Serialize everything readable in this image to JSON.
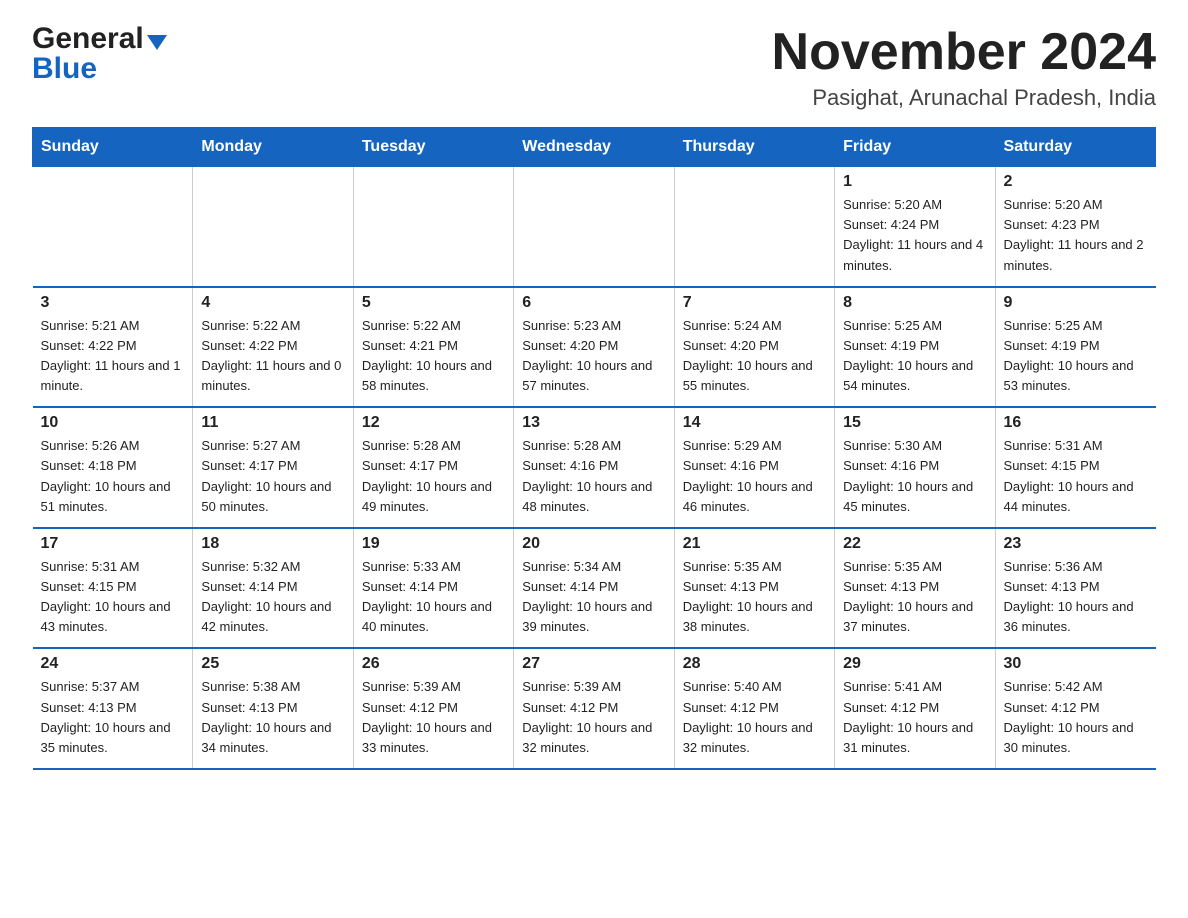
{
  "header": {
    "logo_general": "General",
    "logo_blue": "Blue",
    "month_title": "November 2024",
    "location": "Pasighat, Arunachal Pradesh, India"
  },
  "days_of_week": [
    "Sunday",
    "Monday",
    "Tuesday",
    "Wednesday",
    "Thursday",
    "Friday",
    "Saturday"
  ],
  "weeks": [
    [
      {
        "day": "",
        "info": ""
      },
      {
        "day": "",
        "info": ""
      },
      {
        "day": "",
        "info": ""
      },
      {
        "day": "",
        "info": ""
      },
      {
        "day": "",
        "info": ""
      },
      {
        "day": "1",
        "info": "Sunrise: 5:20 AM\nSunset: 4:24 PM\nDaylight: 11 hours and 4 minutes."
      },
      {
        "day": "2",
        "info": "Sunrise: 5:20 AM\nSunset: 4:23 PM\nDaylight: 11 hours and 2 minutes."
      }
    ],
    [
      {
        "day": "3",
        "info": "Sunrise: 5:21 AM\nSunset: 4:22 PM\nDaylight: 11 hours and 1 minute."
      },
      {
        "day": "4",
        "info": "Sunrise: 5:22 AM\nSunset: 4:22 PM\nDaylight: 11 hours and 0 minutes."
      },
      {
        "day": "5",
        "info": "Sunrise: 5:22 AM\nSunset: 4:21 PM\nDaylight: 10 hours and 58 minutes."
      },
      {
        "day": "6",
        "info": "Sunrise: 5:23 AM\nSunset: 4:20 PM\nDaylight: 10 hours and 57 minutes."
      },
      {
        "day": "7",
        "info": "Sunrise: 5:24 AM\nSunset: 4:20 PM\nDaylight: 10 hours and 55 minutes."
      },
      {
        "day": "8",
        "info": "Sunrise: 5:25 AM\nSunset: 4:19 PM\nDaylight: 10 hours and 54 minutes."
      },
      {
        "day": "9",
        "info": "Sunrise: 5:25 AM\nSunset: 4:19 PM\nDaylight: 10 hours and 53 minutes."
      }
    ],
    [
      {
        "day": "10",
        "info": "Sunrise: 5:26 AM\nSunset: 4:18 PM\nDaylight: 10 hours and 51 minutes."
      },
      {
        "day": "11",
        "info": "Sunrise: 5:27 AM\nSunset: 4:17 PM\nDaylight: 10 hours and 50 minutes."
      },
      {
        "day": "12",
        "info": "Sunrise: 5:28 AM\nSunset: 4:17 PM\nDaylight: 10 hours and 49 minutes."
      },
      {
        "day": "13",
        "info": "Sunrise: 5:28 AM\nSunset: 4:16 PM\nDaylight: 10 hours and 48 minutes."
      },
      {
        "day": "14",
        "info": "Sunrise: 5:29 AM\nSunset: 4:16 PM\nDaylight: 10 hours and 46 minutes."
      },
      {
        "day": "15",
        "info": "Sunrise: 5:30 AM\nSunset: 4:16 PM\nDaylight: 10 hours and 45 minutes."
      },
      {
        "day": "16",
        "info": "Sunrise: 5:31 AM\nSunset: 4:15 PM\nDaylight: 10 hours and 44 minutes."
      }
    ],
    [
      {
        "day": "17",
        "info": "Sunrise: 5:31 AM\nSunset: 4:15 PM\nDaylight: 10 hours and 43 minutes."
      },
      {
        "day": "18",
        "info": "Sunrise: 5:32 AM\nSunset: 4:14 PM\nDaylight: 10 hours and 42 minutes."
      },
      {
        "day": "19",
        "info": "Sunrise: 5:33 AM\nSunset: 4:14 PM\nDaylight: 10 hours and 40 minutes."
      },
      {
        "day": "20",
        "info": "Sunrise: 5:34 AM\nSunset: 4:14 PM\nDaylight: 10 hours and 39 minutes."
      },
      {
        "day": "21",
        "info": "Sunrise: 5:35 AM\nSunset: 4:13 PM\nDaylight: 10 hours and 38 minutes."
      },
      {
        "day": "22",
        "info": "Sunrise: 5:35 AM\nSunset: 4:13 PM\nDaylight: 10 hours and 37 minutes."
      },
      {
        "day": "23",
        "info": "Sunrise: 5:36 AM\nSunset: 4:13 PM\nDaylight: 10 hours and 36 minutes."
      }
    ],
    [
      {
        "day": "24",
        "info": "Sunrise: 5:37 AM\nSunset: 4:13 PM\nDaylight: 10 hours and 35 minutes."
      },
      {
        "day": "25",
        "info": "Sunrise: 5:38 AM\nSunset: 4:13 PM\nDaylight: 10 hours and 34 minutes."
      },
      {
        "day": "26",
        "info": "Sunrise: 5:39 AM\nSunset: 4:12 PM\nDaylight: 10 hours and 33 minutes."
      },
      {
        "day": "27",
        "info": "Sunrise: 5:39 AM\nSunset: 4:12 PM\nDaylight: 10 hours and 32 minutes."
      },
      {
        "day": "28",
        "info": "Sunrise: 5:40 AM\nSunset: 4:12 PM\nDaylight: 10 hours and 32 minutes."
      },
      {
        "day": "29",
        "info": "Sunrise: 5:41 AM\nSunset: 4:12 PM\nDaylight: 10 hours and 31 minutes."
      },
      {
        "day": "30",
        "info": "Sunrise: 5:42 AM\nSunset: 4:12 PM\nDaylight: 10 hours and 30 minutes."
      }
    ]
  ]
}
